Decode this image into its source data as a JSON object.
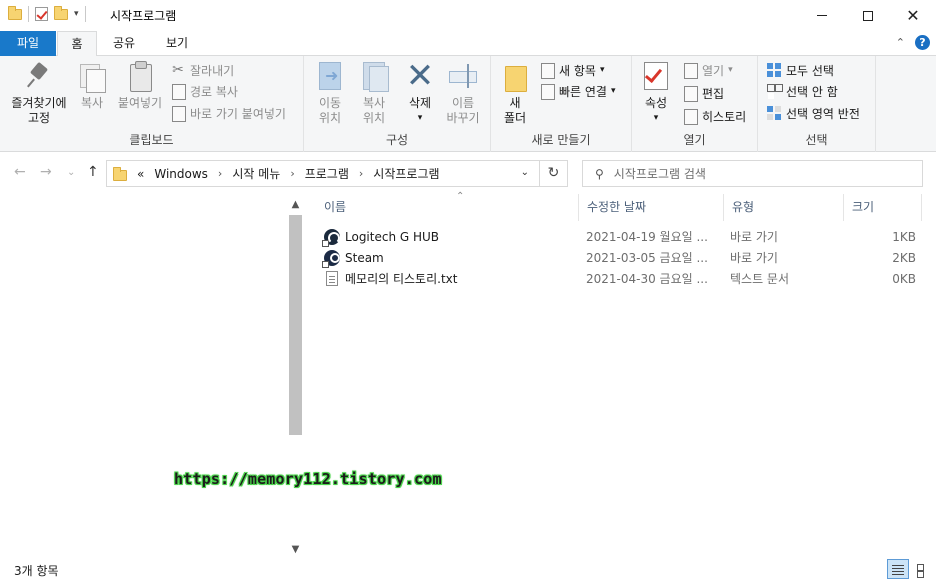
{
  "window": {
    "title": "시작프로그램",
    "minimize": "–",
    "maximize": "□",
    "close": "✕"
  },
  "tabs": [
    {
      "label": "파일"
    },
    {
      "label": "홈"
    },
    {
      "label": "공유"
    },
    {
      "label": "보기"
    }
  ],
  "ribbon": {
    "clipboard": {
      "label": "클립보드",
      "pin_l1": "즐겨찾기에",
      "pin_l2": "고정",
      "copy": "복사",
      "paste": "붙여넣기",
      "cut": "잘라내기",
      "copy_path": "경로 복사",
      "paste_shortcut": "바로 가기 붙여넣기"
    },
    "organize": {
      "label": "구성",
      "move_l1": "이동",
      "move_l2": "위치",
      "copyto_l1": "복사",
      "copyto_l2": "위치",
      "delete": "삭제",
      "rename_l1": "이름",
      "rename_l2": "바꾸기"
    },
    "new": {
      "label": "새로 만들기",
      "folder_l1": "새",
      "folder_l2": "폴더",
      "new_item": "새 항목",
      "easy_access": "빠른 연결"
    },
    "open": {
      "label": "열기",
      "properties": "속성",
      "open": "열기",
      "edit": "편집",
      "history": "히스토리"
    },
    "select": {
      "label": "선택",
      "select_all": "모두 선택",
      "select_none": "선택 안 함",
      "invert": "선택 영역 반전"
    }
  },
  "address": {
    "overflow": "«",
    "crumbs": [
      "Windows",
      "시작 메뉴",
      "프로그램",
      "시작프로그램"
    ],
    "refresh": "↻"
  },
  "search": {
    "placeholder": "시작프로그램 검색"
  },
  "columns": {
    "name": "이름",
    "date": "수정한 날짜",
    "type": "유형",
    "size": "크기"
  },
  "files": [
    {
      "name": "Logitech G HUB",
      "date": "2021-04-19 월요일 ...",
      "type": "바로 가기",
      "size": "1KB"
    },
    {
      "name": "Steam",
      "date": "2021-03-05 금요일 ...",
      "type": "바로 가기",
      "size": "2KB"
    },
    {
      "name": "메모리의 티스토리.txt",
      "date": "2021-04-30 금요일 ...",
      "type": "텍스트 문서",
      "size": "0KB"
    }
  ],
  "watermark": "https://memory112.tistory.com",
  "status": {
    "item_count": "3개 항목"
  },
  "colors": {
    "accent": "#1979ca",
    "ribbon_bg": "#f5f6f7",
    "header_text": "#4c607a"
  }
}
